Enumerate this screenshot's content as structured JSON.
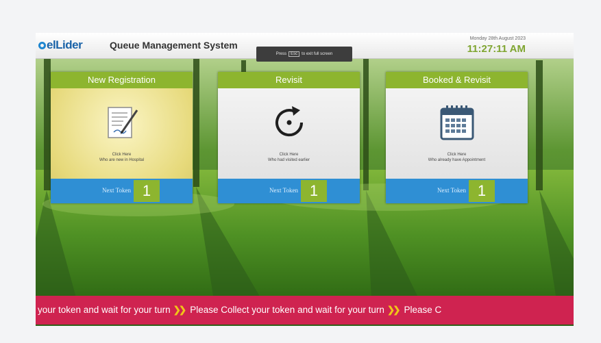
{
  "header": {
    "logo_text": "elLider",
    "app_title": "Queue Management System",
    "hint": {
      "prefix": "Press",
      "key": "Esc",
      "suffix": "to exit full screen"
    },
    "date": "Monday 28th August 2023",
    "time": "11:27:11 AM"
  },
  "cards": [
    {
      "title": "New Registration",
      "click_line1": "Click Here",
      "click_line2": "Who are new in Hospital",
      "next_token_label": "Next Token",
      "token": "1",
      "icon": "document-pen-icon"
    },
    {
      "title": "Revisit",
      "click_line1": "Click Here",
      "click_line2": "Who had visited earlier",
      "next_token_label": "Next Token",
      "token": "1",
      "icon": "refresh-icon"
    },
    {
      "title": "Booked & Revisit",
      "click_line1": "Click Here",
      "click_line2": "Who already have Appointment",
      "next_token_label": "Next Token",
      "token": "1",
      "icon": "calendar-icon"
    }
  ],
  "ticker": {
    "segments": [
      "your token and wait for your turn",
      "Please Collect your token and wait for your turn",
      "Please C"
    ],
    "separator_icon": "double-chevron-icon"
  },
  "colors": {
    "accent_green": "#8db52f",
    "token_blue": "#2f8fd4",
    "ticker_red": "#cf2350",
    "clock_green": "#7fa531"
  }
}
